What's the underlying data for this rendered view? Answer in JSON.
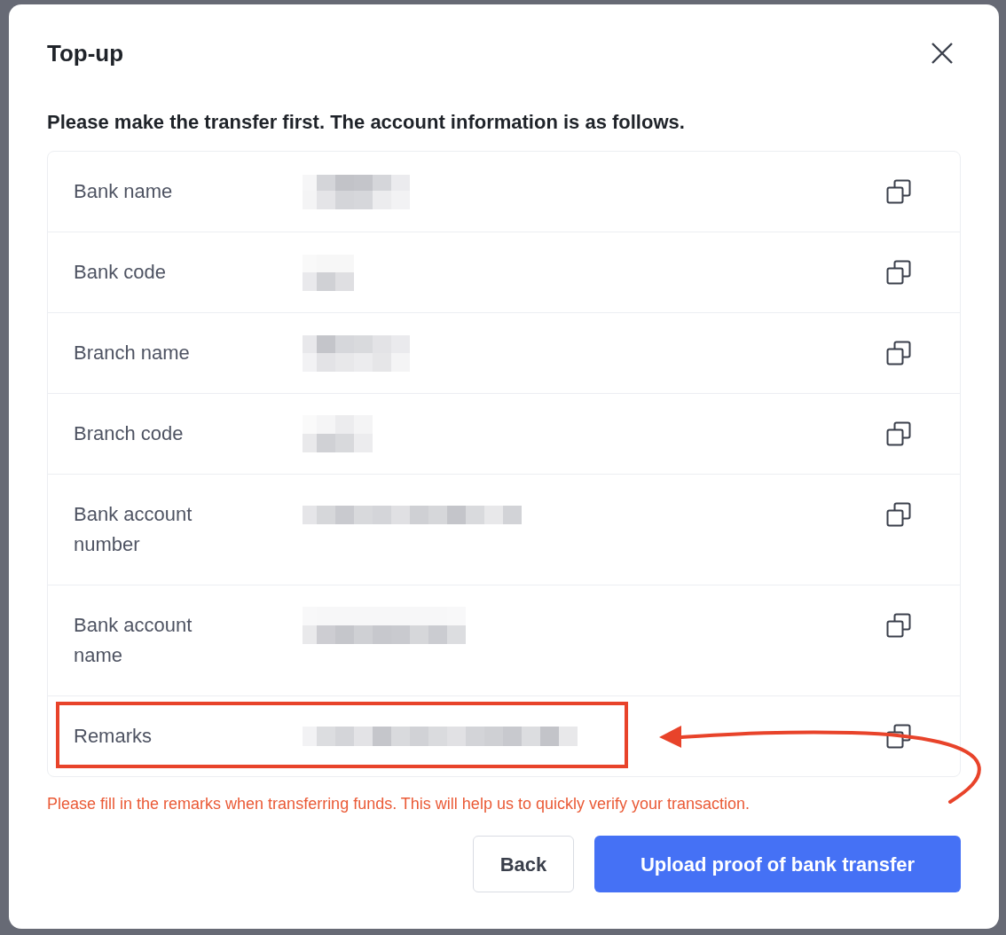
{
  "dialog": {
    "title": "Top-up",
    "intro": "Please make the transfer first. The account information is as follows."
  },
  "account_rows": [
    {
      "label": "Bank name",
      "highlighted": false
    },
    {
      "label": "Bank code",
      "highlighted": false
    },
    {
      "label": "Branch name",
      "highlighted": false
    },
    {
      "label": "Branch code",
      "highlighted": false
    },
    {
      "label": "Bank account number",
      "highlighted": false
    },
    {
      "label": "Bank account name",
      "highlighted": false
    },
    {
      "label": "Remarks",
      "highlighted": true
    }
  ],
  "annotation_arrow": true,
  "notice": "Please fill in the remarks when transferring funds. This will help us to quickly verify your transaction.",
  "buttons": [
    {
      "label": "Back",
      "kind": "secondary"
    },
    {
      "label": "Upload proof of bank transfer",
      "kind": "primary"
    }
  ]
}
